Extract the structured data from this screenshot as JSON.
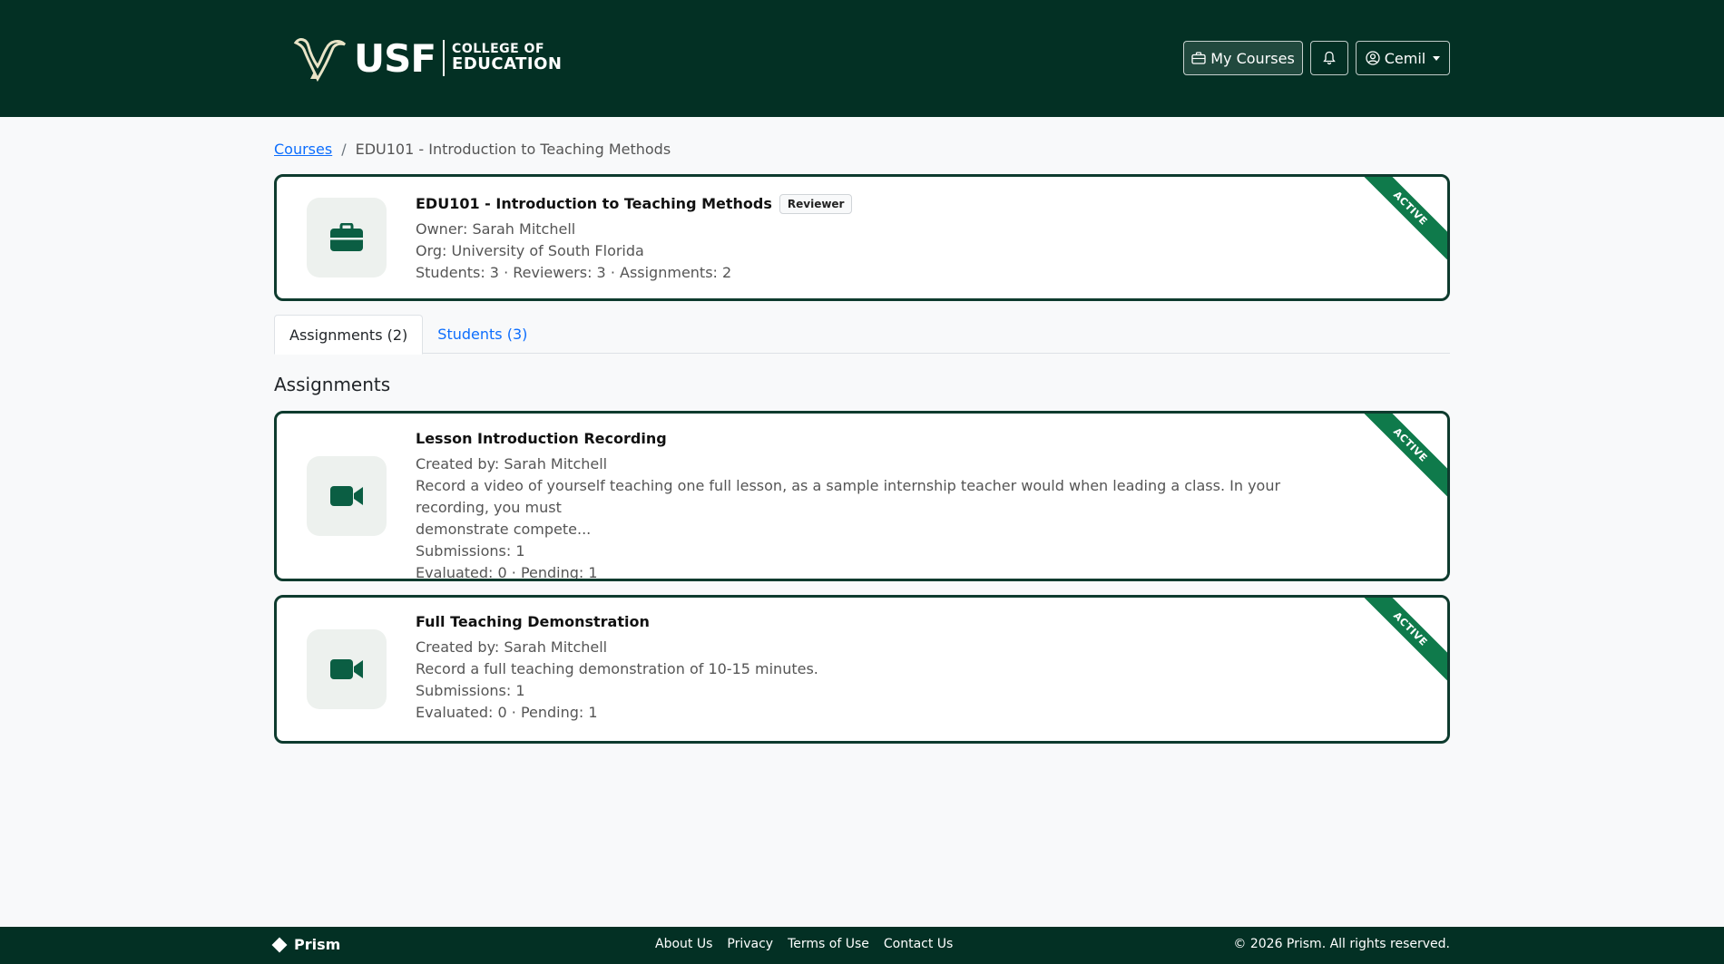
{
  "header": {
    "logo_usf": "USF",
    "logo_line1": "COLLEGE OF",
    "logo_line2": "EDUCATION",
    "my_courses_label": "My Courses",
    "user_label": "Cemil"
  },
  "breadcrumb": {
    "root": "Courses",
    "separator": "/",
    "current": "EDU101 - Introduction to Teaching Methods"
  },
  "course": {
    "title": "EDU101 - Introduction to Teaching Methods",
    "role_badge": "Reviewer",
    "owner": "Owner: Sarah Mitchell",
    "org": "Org: University of South Florida",
    "stats": "Students: 3 · Reviewers: 3 · Assignments: 2",
    "status_ribbon": "ACTIVE",
    "icon": "briefcase-icon"
  },
  "tabs": [
    {
      "label": "Assignments (2)",
      "active": true
    },
    {
      "label": "Students (3)",
      "active": false
    }
  ],
  "section_heading": "Assignments",
  "assignments": [
    {
      "title": "Lesson Introduction Recording",
      "created_by": "Created by: Sarah Mitchell",
      "description_line1": "Record a video of yourself teaching one full lesson, as a sample internship teacher would when leading a class. In your recording, you must",
      "description_line2": "demonstrate compete...",
      "submissions": "Submissions: 1",
      "evaluation": "Evaluated: 0 · Pending: 1",
      "status_ribbon": "ACTIVE",
      "icon": "video-camera-icon"
    },
    {
      "title": "Full Teaching Demonstration",
      "created_by": "Created by: Sarah Mitchell",
      "description_line1": "Record a full teaching demonstration of 10-15 minutes.",
      "submissions": "Submissions: 1",
      "evaluation": "Evaluated: 0 · Pending: 1",
      "status_ribbon": "ACTIVE",
      "icon": "video-camera-icon"
    }
  ],
  "footer": {
    "brand": "Prism",
    "links": [
      "About Us",
      "Privacy",
      "Terms of Use",
      "Contact Us"
    ],
    "copyright": "© 2026 Prism. All rights reserved."
  },
  "colors": {
    "header_bg": "#033024",
    "accent_green": "#0f7a4b",
    "card_border": "#0e3b2e",
    "link_blue": "#0d6efd"
  }
}
